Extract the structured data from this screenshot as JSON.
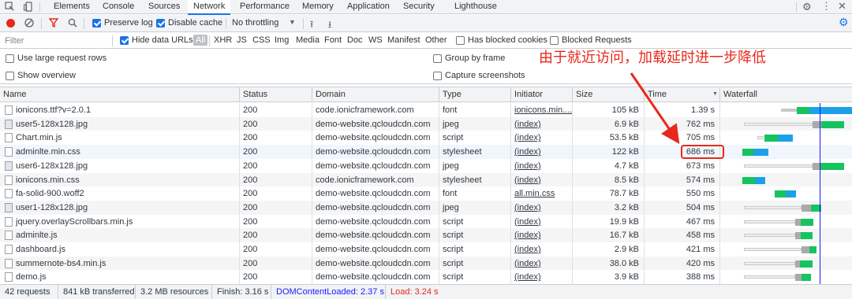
{
  "tabs": [
    "Elements",
    "Console",
    "Sources",
    "Network",
    "Performance",
    "Memory",
    "Application",
    "Security",
    "Lighthouse"
  ],
  "toolbar": {
    "preserve_log": "Preserve log",
    "disable_cache": "Disable cache",
    "throttling": "No throttling"
  },
  "filter": {
    "placeholder": "Filter",
    "hide_data_urls": "Hide data URLs",
    "types": [
      "All",
      "XHR",
      "JS",
      "CSS",
      "Img",
      "Media",
      "Font",
      "Doc",
      "WS",
      "Manifest",
      "Other"
    ],
    "has_blocked_cookies": "Has blocked cookies",
    "blocked_requests": "Blocked Requests"
  },
  "options": {
    "large_rows": "Use large request rows",
    "show_overview": "Show overview",
    "group_by_frame": "Group by frame",
    "capture_screenshots": "Capture screenshots"
  },
  "annotation": "由于就近访问，加载延时进一步降低",
  "columns": [
    "Name",
    "Status",
    "Domain",
    "Type",
    "Initiator",
    "Size",
    "Time",
    "Waterfall"
  ],
  "rows": [
    {
      "name": "ionicons.ttf?v=2.0.1",
      "status": "200",
      "domain": "code.ionicframework.com",
      "type": "font",
      "initiator": "ionicons.min....",
      "size": "105 kB",
      "time": "1.39 s",
      "icon": "file"
    },
    {
      "name": "user5-128x128.jpg",
      "status": "200",
      "domain": "demo-website.qcloudcdn.com",
      "type": "jpeg",
      "initiator": "(index)",
      "size": "6.9 kB",
      "time": "762 ms",
      "icon": "image"
    },
    {
      "name": "Chart.min.js",
      "status": "200",
      "domain": "demo-website.qcloudcdn.com",
      "type": "script",
      "initiator": "(index)",
      "size": "53.5 kB",
      "time": "705 ms",
      "icon": "file"
    },
    {
      "name": "adminlte.min.css",
      "status": "200",
      "domain": "demo-website.qcloudcdn.com",
      "type": "stylesheet",
      "initiator": "(index)",
      "size": "122 kB",
      "time": "686 ms",
      "icon": "file"
    },
    {
      "name": "user6-128x128.jpg",
      "status": "200",
      "domain": "demo-website.qcloudcdn.com",
      "type": "jpeg",
      "initiator": "(index)",
      "size": "4.7 kB",
      "time": "673 ms",
      "icon": "image"
    },
    {
      "name": "ionicons.min.css",
      "status": "200",
      "domain": "code.ionicframework.com",
      "type": "stylesheet",
      "initiator": "(index)",
      "size": "8.5 kB",
      "time": "574 ms",
      "icon": "file"
    },
    {
      "name": "fa-solid-900.woff2",
      "status": "200",
      "domain": "demo-website.qcloudcdn.com",
      "type": "font",
      "initiator": "all.min.css",
      "size": "78.7 kB",
      "time": "550 ms",
      "icon": "file"
    },
    {
      "name": "user1-128x128.jpg",
      "status": "200",
      "domain": "demo-website.qcloudcdn.com",
      "type": "jpeg",
      "initiator": "(index)",
      "size": "3.2 kB",
      "time": "504 ms",
      "icon": "image"
    },
    {
      "name": "jquery.overlayScrollbars.min.js",
      "status": "200",
      "domain": "demo-website.qcloudcdn.com",
      "type": "script",
      "initiator": "(index)",
      "size": "19.9 kB",
      "time": "467 ms",
      "icon": "file"
    },
    {
      "name": "adminlte.js",
      "status": "200",
      "domain": "demo-website.qcloudcdn.com",
      "type": "script",
      "initiator": "(index)",
      "size": "16.7 kB",
      "time": "458 ms",
      "icon": "file"
    },
    {
      "name": "dashboard.js",
      "status": "200",
      "domain": "demo-website.qcloudcdn.com",
      "type": "script",
      "initiator": "(index)",
      "size": "2.9 kB",
      "time": "421 ms",
      "icon": "file"
    },
    {
      "name": "summernote-bs4.min.js",
      "status": "200",
      "domain": "demo-website.qcloudcdn.com",
      "type": "script",
      "initiator": "(index)",
      "size": "38.0 kB",
      "time": "420 ms",
      "icon": "file"
    },
    {
      "name": "demo.js",
      "status": "200",
      "domain": "demo-website.qcloudcdn.com",
      "type": "script",
      "initiator": "(index)",
      "size": "3.9 kB",
      "time": "388 ms",
      "icon": "file"
    }
  ],
  "status": {
    "requests": "42 requests",
    "transferred": "841 kB transferred",
    "resources": "3.2 MB resources",
    "finish": "Finish: 3.16 s",
    "dcl": "DOMContentLoaded: 2.37 s",
    "load": "Load: 3.24 s"
  },
  "colors": {
    "accent": "#1a73e8",
    "annotation": "#e8281b",
    "waiting": "#16c35e",
    "download": "#1ca1e8",
    "queue": "#c8c8c8",
    "dcl": "#1a1aff",
    "load": "#e8281b"
  }
}
